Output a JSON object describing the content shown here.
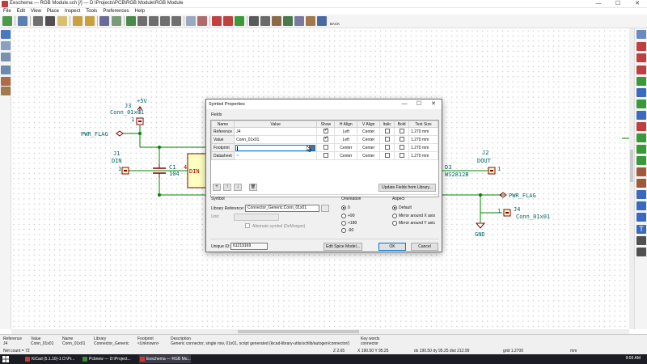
{
  "window": {
    "title": "Eeschema — RGB Module.sch [/] — D:\\Projects\\PCB\\RGB Module\\RGB Module",
    "minimize": "—",
    "maximize": "☐",
    "close": "✕"
  },
  "menu": [
    "File",
    "Edit",
    "View",
    "Place",
    "Inspect",
    "Tools",
    "Preferences",
    "Help"
  ],
  "toolbar": {
    "back_label": "BACK"
  },
  "schematic": {
    "j3_ref": "J3",
    "j3_value": "Conn_01x01",
    "plus5v": "+5V",
    "pin1_top": "1",
    "pwr_flag_left": "PWR_FLAG",
    "j1_ref": "J1",
    "j1_name": "DIN",
    "pin1_left": "1",
    "c1_ref": "C1",
    "c1_value": "104",
    "pin4": "4",
    "din_pin": "DIN",
    "j2_ref": "J2",
    "j2_name": "DOUT",
    "d3_ref": "D3",
    "d3_value": "WS2812B",
    "pin1_right": "1",
    "pwr_flag_right": "PWR_FLAG",
    "j4_ref": "J4",
    "j4_value": "Conn_01x01",
    "pin1_j4": "1",
    "gnd": "GND",
    "pwr_flag_left_left": "PWR_FLAG",
    "right_pin": "1"
  },
  "dialog": {
    "title": "Symbol Properties",
    "fields_section": "Fields",
    "columns": [
      "Name",
      "Value",
      "Show",
      "H Align",
      "V Align",
      "Italic",
      "Bold",
      "Text Size"
    ],
    "rows": [
      {
        "name": "Reference",
        "value": "J4",
        "show": true,
        "halign": "Left",
        "valign": "Center",
        "italic": false,
        "bold": false,
        "size": "1.270 mm"
      },
      {
        "name": "Value",
        "value": "Conn_01x01",
        "show": true,
        "halign": "Left",
        "valign": "Center",
        "italic": false,
        "bold": false,
        "size": "1.270 mm"
      },
      {
        "name": "Footprint",
        "value": "",
        "show": false,
        "halign": "Center",
        "valign": "Center",
        "italic": false,
        "bold": false,
        "size": "1.270 mm"
      },
      {
        "name": "Datasheet",
        "value": "~",
        "show": false,
        "halign": "Center",
        "valign": "Center",
        "italic": false,
        "bold": false,
        "size": "1.270 mm"
      }
    ],
    "add_icon": "+",
    "up_icon": "↑",
    "down_icon": "↓",
    "delete_icon": "🗑",
    "update_fields_button": "Update Fields from Library...",
    "symbol_section": "Symbol",
    "library_reference_label": "Library Reference:",
    "library_reference_value": "Connector_Generic:Conn_01x01",
    "unit_label": "Unit:",
    "alternate_symbol_label": "Alternate symbol (DeMorgan)",
    "orientation_section": "Orientation",
    "orientations": [
      "0",
      "+90",
      "+180",
      "-90"
    ],
    "orientation_selected_index": 0,
    "aspect_section": "Aspect",
    "aspects": [
      "Default",
      "Mirror around X axis",
      "Mirror around Y axis"
    ],
    "aspect_selected_index": 0,
    "unique_id_label": "Unique ID:",
    "unique_id_value": "61219169",
    "edit_spice_button": "Edit Spice Model...",
    "ok_button": "OK",
    "cancel_button": "Cancel"
  },
  "message_panel": {
    "columns": [
      {
        "label": "Reference",
        "value": "J4"
      },
      {
        "label": "Value",
        "value": "Conn_01x01"
      },
      {
        "label": "Name",
        "value": "Conn_01x01"
      },
      {
        "label": "Library",
        "value": "Connector_Generic"
      },
      {
        "label": "Footprint",
        "value": "<Unknown>"
      },
      {
        "label": "Description",
        "value": "Generic connector, single row, 01x01, script generated (kicad-library-utils/schlib/autogen/connector/)"
      },
      {
        "label": "Key words",
        "value": "connector"
      }
    ],
    "net_count": "Net count = 72",
    "z": "Z 2.65",
    "xy": "X 190.50  Y 95.25",
    "dxdy": "dx 190.50  dy 95.25  dist 212.99",
    "grid": "grid 1.2700",
    "units": "mm"
  },
  "taskbar": {
    "items": [
      "KiCad (5.1.10)-1 D:\\Pr...",
      "Pcbnew — D:\\Project...",
      "Eeschema — RGB Mo..."
    ],
    "clock": "9:56 AM"
  },
  "colors": {
    "wire": "#008400",
    "schematic_text": "#006464",
    "component_body": "#ffffc2",
    "component_outline": "#840000",
    "accent": "#0078d7"
  }
}
